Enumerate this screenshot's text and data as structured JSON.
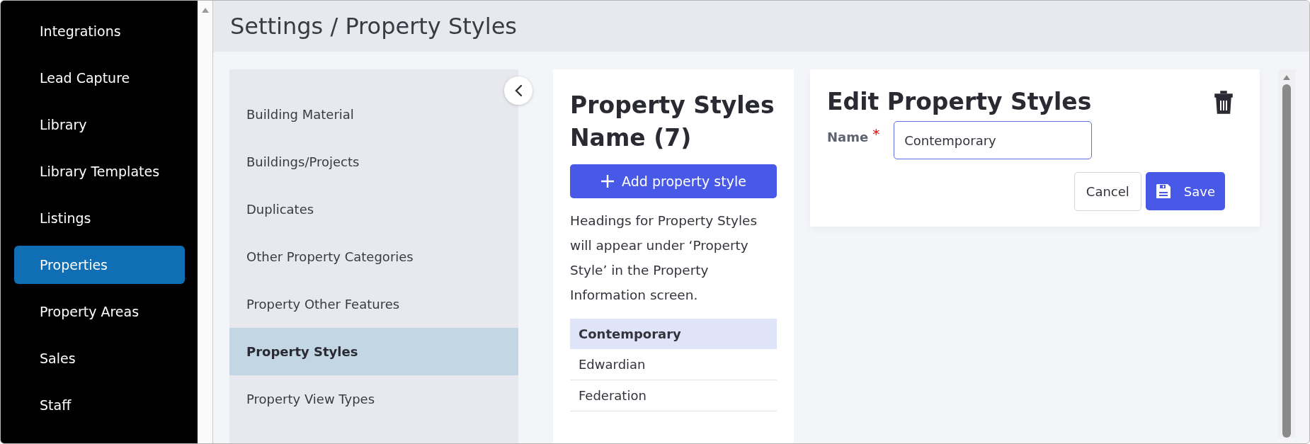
{
  "sidebar": {
    "items": [
      {
        "label": "Integrations",
        "selected": false
      },
      {
        "label": "Lead Capture",
        "selected": false
      },
      {
        "label": "Library",
        "selected": false
      },
      {
        "label": "Library Templates",
        "selected": false
      },
      {
        "label": "Listings",
        "selected": false
      },
      {
        "label": "Properties",
        "selected": true
      },
      {
        "label": "Property Areas",
        "selected": false
      },
      {
        "label": "Sales",
        "selected": false
      },
      {
        "label": "Staff",
        "selected": false
      }
    ]
  },
  "header": {
    "title": "Settings / Property Styles"
  },
  "settings_menu": {
    "items": [
      {
        "label": "Building Material",
        "selected": false
      },
      {
        "label": "Buildings/Projects",
        "selected": false
      },
      {
        "label": "Duplicates",
        "selected": false
      },
      {
        "label": "Other Property Categories",
        "selected": false
      },
      {
        "label": "Property Other Features",
        "selected": false
      },
      {
        "label": "Property Styles",
        "selected": true
      },
      {
        "label": "Property View Types",
        "selected": false
      }
    ]
  },
  "styles_panel": {
    "heading": "Property Styles Name (7)",
    "add_button": "Add property style",
    "description": "Headings for Property Styles will appear under ‘Property Style’ in the Property Information screen.",
    "items": [
      {
        "label": "Contemporary",
        "selected": true
      },
      {
        "label": "Edwardian",
        "selected": false
      },
      {
        "label": "Federation",
        "selected": false
      }
    ]
  },
  "edit_panel": {
    "title": "Edit Property Styles",
    "name_label": "Name",
    "required_mark": "*",
    "name_value": "Contemporary",
    "cancel_button": "Cancel",
    "save_button": "Save"
  }
}
